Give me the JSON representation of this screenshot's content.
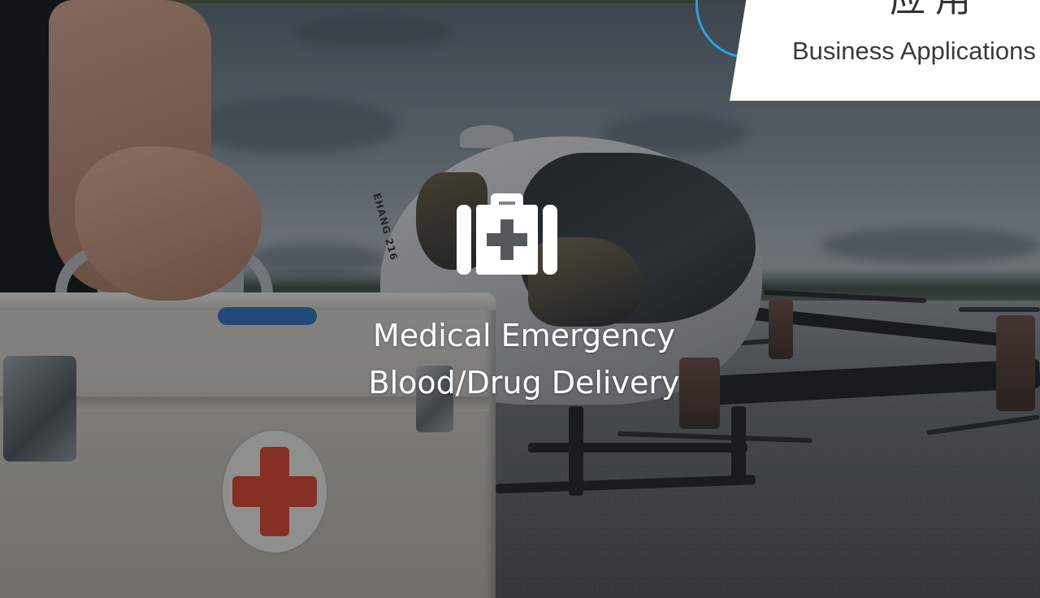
{
  "header": {
    "title_zh": "应用",
    "subtitle_en": "Business Applications",
    "accent_color": "#2aa3e0"
  },
  "feature": {
    "icon": "medical-kit-icon",
    "line1": "Medical Emergency",
    "line2": "Blood/Drug Delivery"
  },
  "drone": {
    "side_marking": "EHANG 216"
  }
}
